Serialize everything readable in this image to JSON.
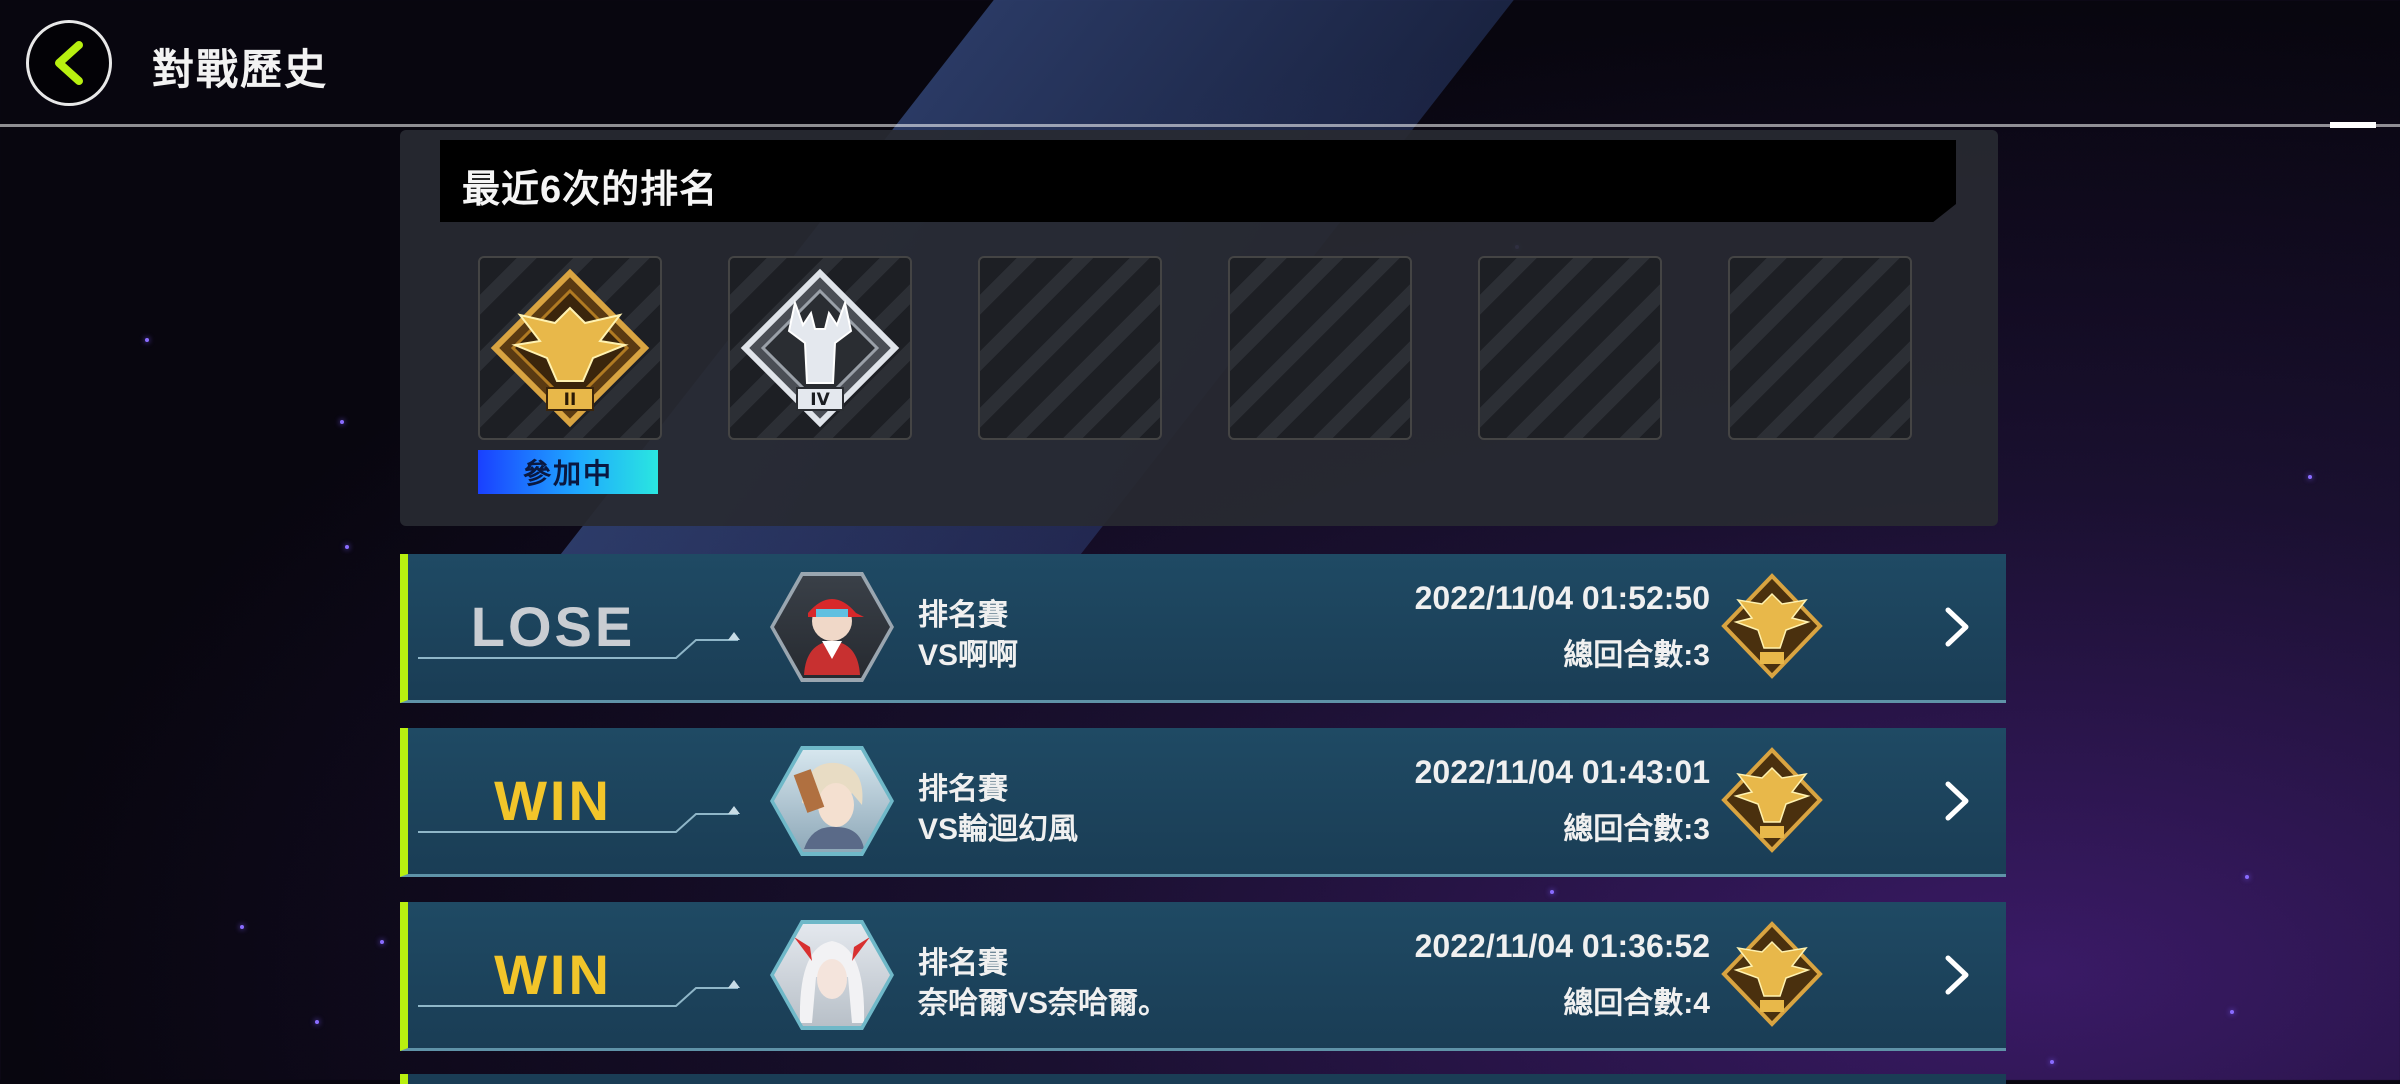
{
  "header": {
    "title": "對戰歷史",
    "back_icon": "chevron-left-icon",
    "accent_color": "#b8f010"
  },
  "rank_history": {
    "title": "最近6次的排名",
    "active_label": "參加中",
    "slots": [
      {
        "badge": "gold-eagle-rank-icon",
        "tier": "II",
        "state": "filled"
      },
      {
        "badge": "silver-deer-rank-icon",
        "tier": "IV",
        "state": "filled"
      },
      {
        "state": "empty"
      },
      {
        "state": "empty"
      },
      {
        "state": "empty"
      },
      {
        "state": "empty"
      }
    ]
  },
  "matches": [
    {
      "result": "LOSE",
      "type": "排名賽",
      "opponent": "VS啊啊",
      "datetime": "2022/11/04 01:52:50",
      "turns": "總回合數:3",
      "avatar": "red-cap-duelist-avatar",
      "rank_icon": "gold-eagle-rank-icon"
    },
    {
      "result": "WIN",
      "type": "排名賽",
      "opponent": "VS輪迴幻風",
      "datetime": "2022/11/04 01:43:01",
      "turns": "總回合數:3",
      "avatar": "blonde-duelist-avatar",
      "rank_icon": "gold-eagle-rank-icon"
    },
    {
      "result": "WIN",
      "type": "排名賽",
      "opponent": "奈哈爾VS奈哈爾。",
      "datetime": "2022/11/04 01:36:52",
      "turns": "總回合數:4",
      "avatar": "white-hair-duelist-avatar",
      "rank_icon": "gold-eagle-rank-icon"
    }
  ]
}
